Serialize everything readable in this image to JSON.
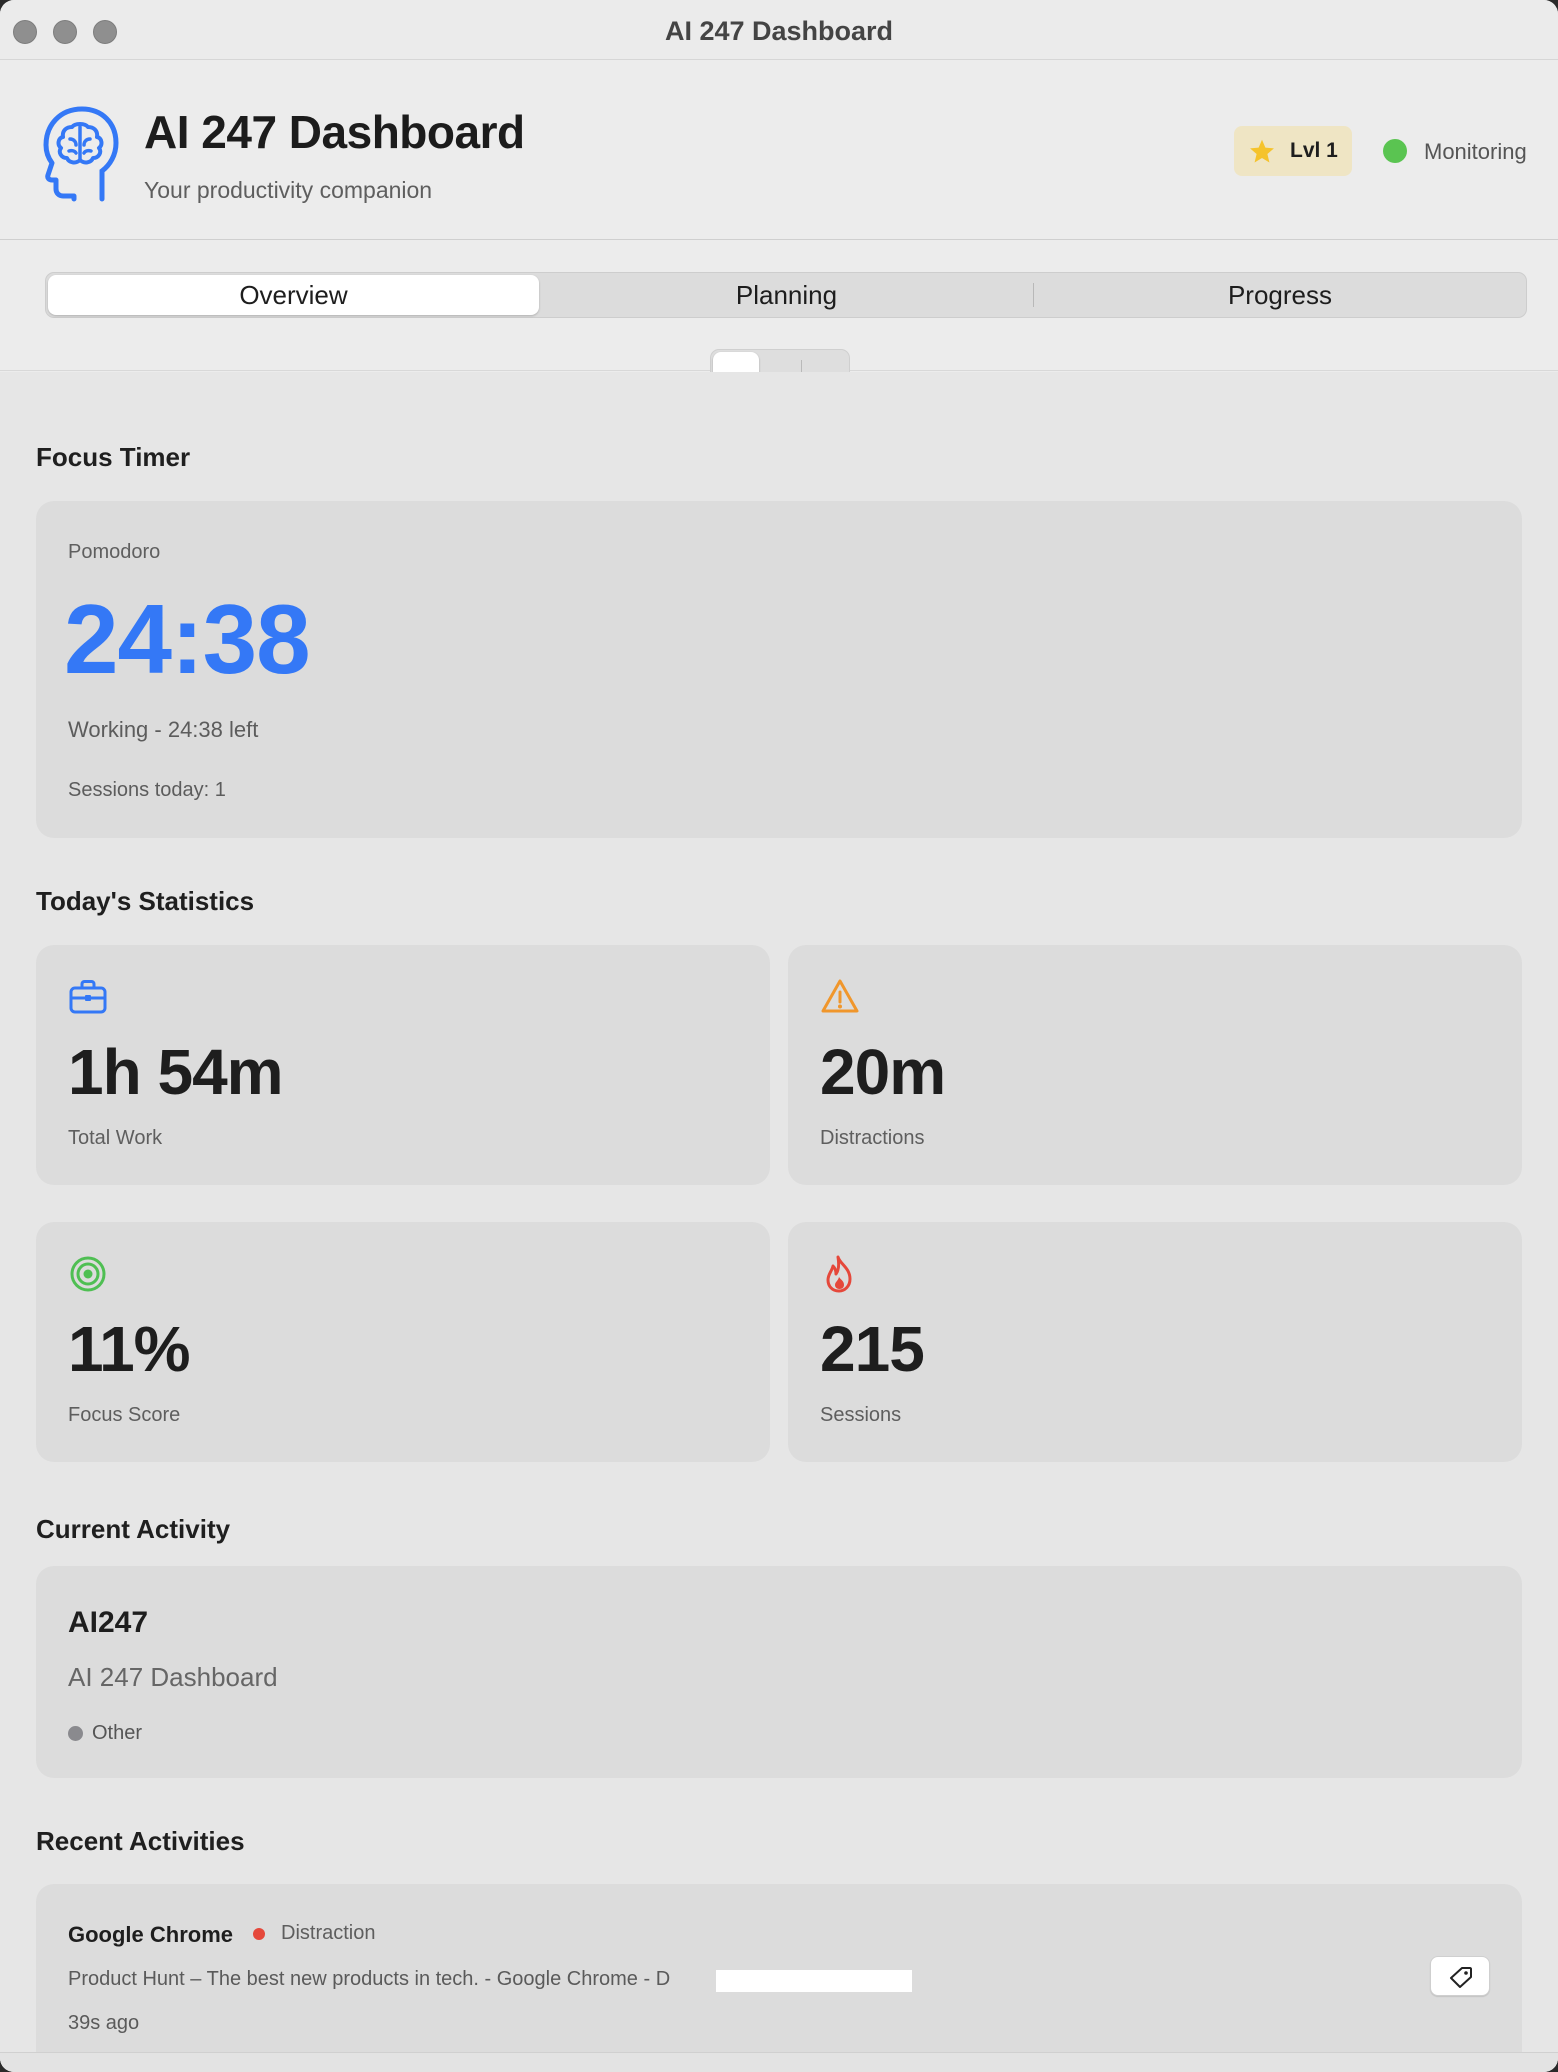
{
  "window": {
    "title": "AI 247 Dashboard"
  },
  "header": {
    "title": "AI 247 Dashboard",
    "subtitle": "Your productivity companion",
    "level": "Lvl 1",
    "status": "Monitoring",
    "icons": {
      "app": "brain-head-icon",
      "level": "star-icon"
    },
    "colors": {
      "accent": "#3478f6",
      "status": "#5ac451",
      "level_bg": "#efe5c4"
    }
  },
  "tabs": [
    {
      "label": "Overview",
      "active": true
    },
    {
      "label": "Planning",
      "active": false
    },
    {
      "label": "Progress",
      "active": false
    }
  ],
  "focus_timer": {
    "section_title": "Focus Timer",
    "mode": "Pomodoro",
    "time": "24:38",
    "status": "Working - 24:38 left",
    "sessions": "Sessions today: 1"
  },
  "statistics": {
    "section_title": "Today's Statistics",
    "cards": [
      {
        "value": "1h 54m",
        "label": "Total Work",
        "icon": "briefcase-icon",
        "color": "#3478f6"
      },
      {
        "value": "20m",
        "label": "Distractions",
        "icon": "warning-icon",
        "color": "#f0962b"
      },
      {
        "value": "11%",
        "label": "Focus Score",
        "icon": "target-icon",
        "color": "#4fbf53"
      },
      {
        "value": "215",
        "label": "Sessions",
        "icon": "flame-icon",
        "color": "#e5483b"
      }
    ]
  },
  "current_activity": {
    "section_title": "Current Activity",
    "app": "AI247",
    "window": "AI 247 Dashboard",
    "category": "Other"
  },
  "recent_activities": {
    "section_title": "Recent Activities",
    "items": [
      {
        "app": "Google Chrome",
        "category": "Distraction",
        "title": "Product Hunt – The best new products in tech. - Google Chrome - D",
        "time": "39s ago",
        "action_icon": "tag-icon"
      }
    ]
  }
}
